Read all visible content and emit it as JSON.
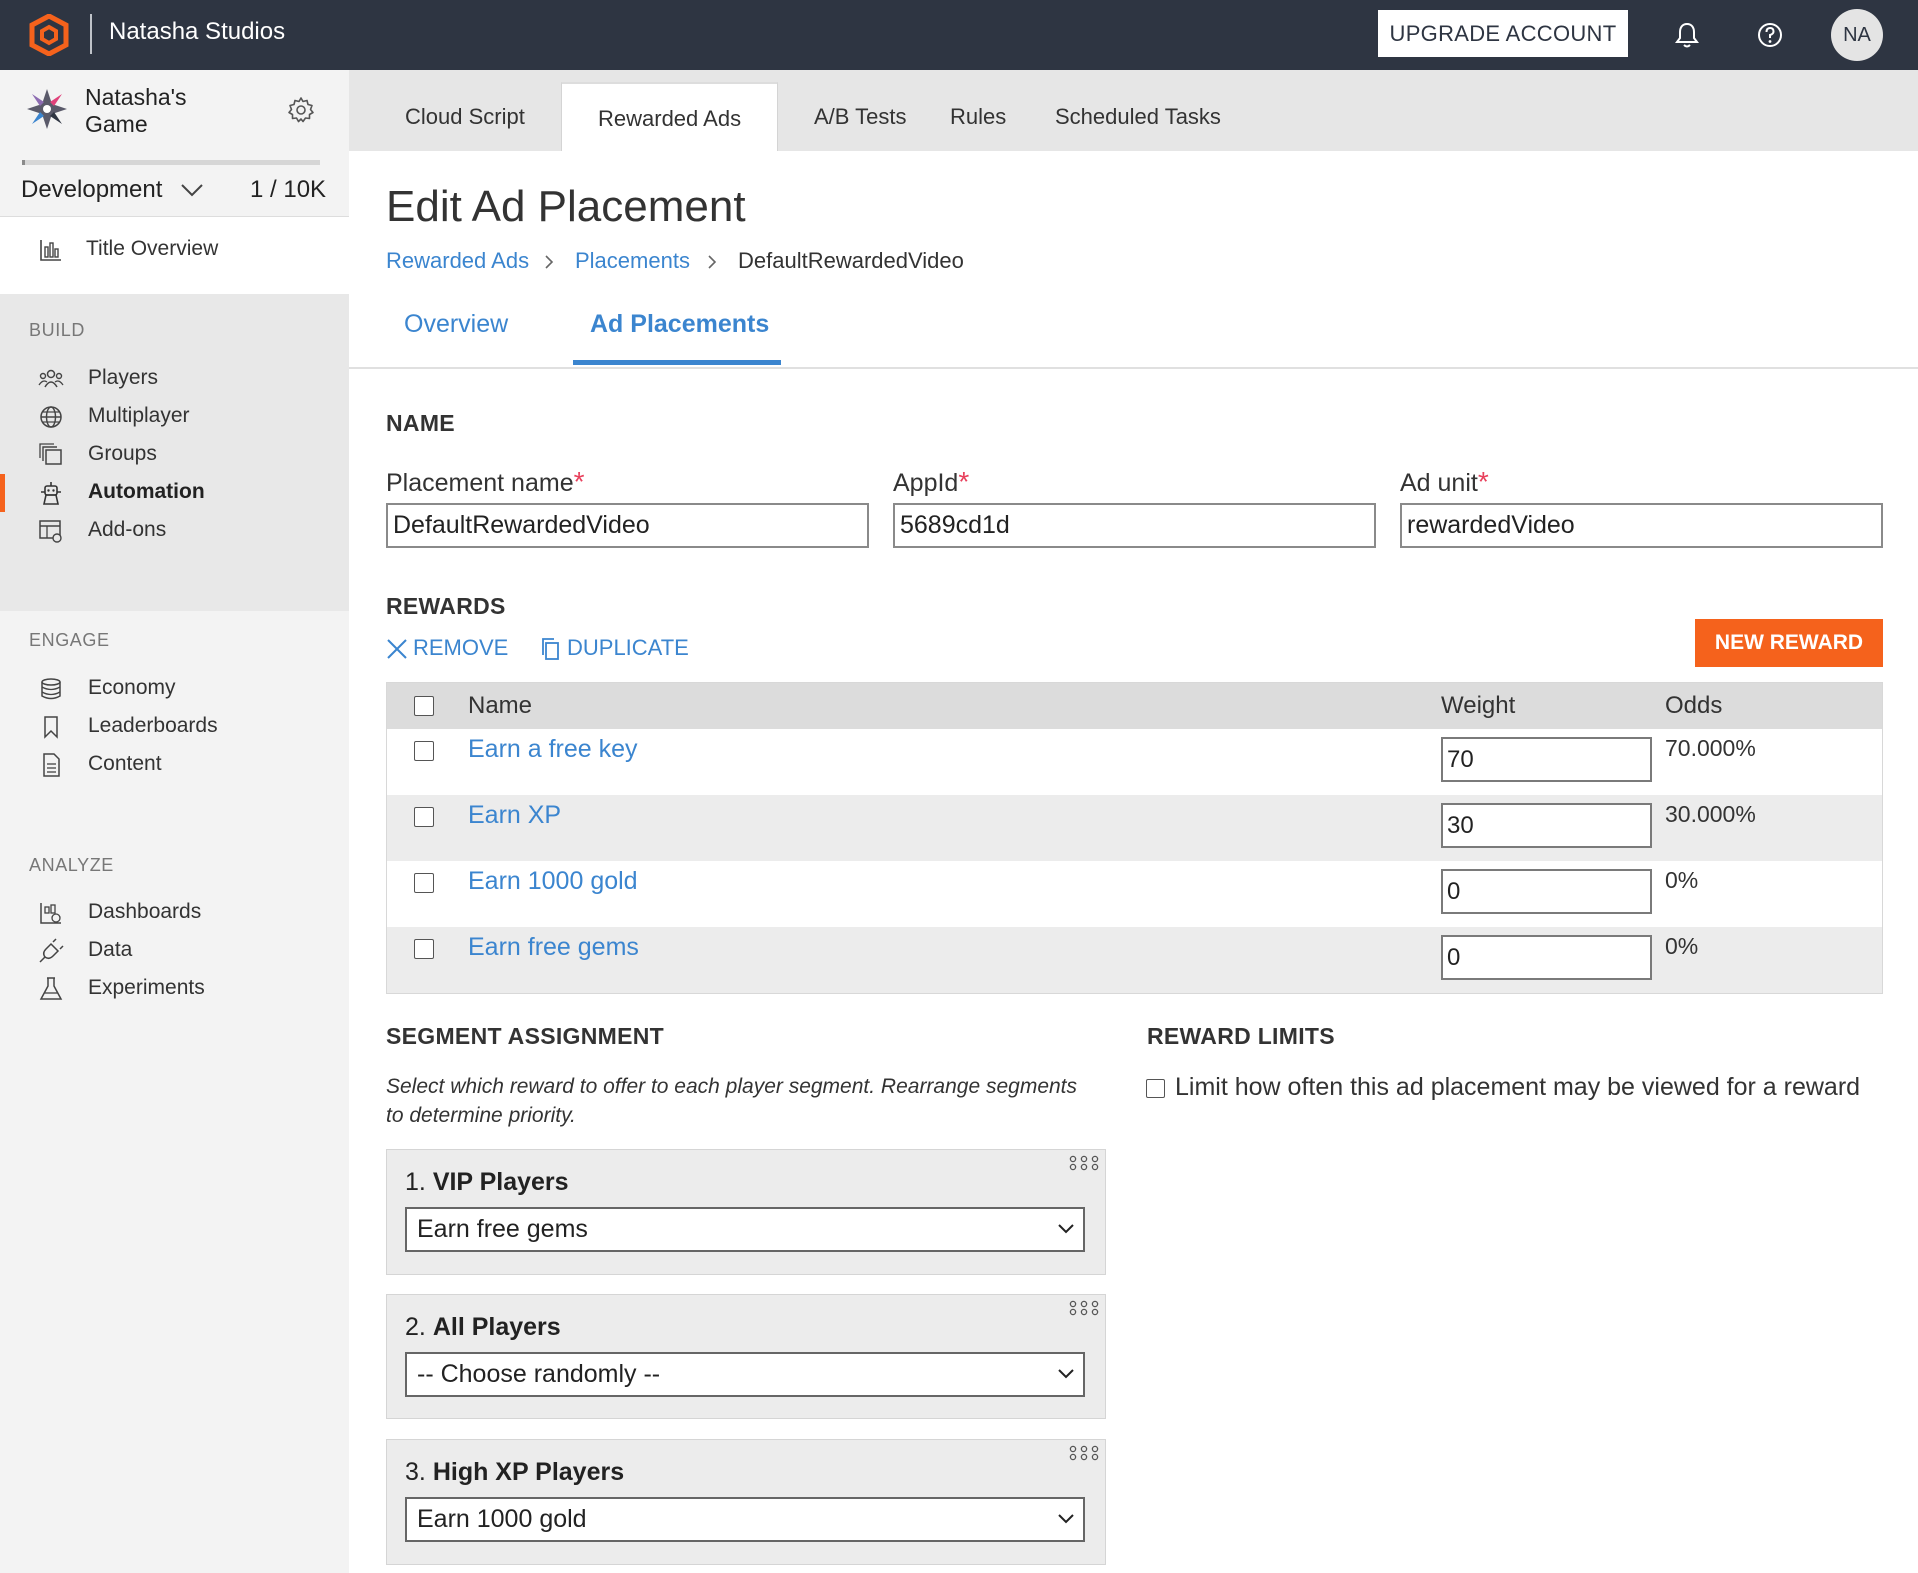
{
  "header": {
    "studio": "Natasha Studios",
    "upgrade_label": "UPGRADE ACCOUNT",
    "avatar": "NA",
    "icons": [
      "bell-icon",
      "help-icon"
    ]
  },
  "sidebar": {
    "game_name": "Natasha's Game",
    "environment": "Development",
    "count": "1 / 10K",
    "usage_fraction": 0.0001,
    "title_overview": "Title Overview",
    "sections": {
      "build": "BUILD",
      "engage": "ENGAGE",
      "analyze": "ANALYZE"
    },
    "build_items": [
      "Players",
      "Multiplayer",
      "Groups",
      "Automation",
      "Add-ons"
    ],
    "engage_items": [
      "Economy",
      "Leaderboards",
      "Content"
    ],
    "analyze_items": [
      "Dashboards",
      "Data",
      "Experiments"
    ],
    "active_item": "Automation"
  },
  "tabs": [
    "Cloud Script",
    "Rewarded Ads",
    "A/B Tests",
    "Rules",
    "Scheduled Tasks"
  ],
  "active_tab": "Rewarded Ads",
  "page": {
    "title": "Edit Ad Placement",
    "breadcrumb": [
      "Rewarded Ads",
      "Placements",
      "DefaultRewardedVideo"
    ],
    "subtabs": [
      "Overview",
      "Ad Placements"
    ],
    "active_subtab": "Ad Placements"
  },
  "name_section": {
    "heading": "NAME",
    "placement_label": "Placement name",
    "placement_value": "DefaultRewardedVideo",
    "appid_label": "AppId",
    "appid_value": "5689cd1d",
    "adunit_label": "Ad unit",
    "adunit_value": "rewardedVideo",
    "required_mark": "*"
  },
  "rewards": {
    "heading": "REWARDS",
    "remove_label": "REMOVE",
    "duplicate_label": "DUPLICATE",
    "new_label": "NEW REWARD",
    "columns": {
      "name": "Name",
      "weight": "Weight",
      "odds": "Odds"
    },
    "rows": [
      {
        "name": "Earn a free key",
        "weight": "70",
        "odds": "70.000%"
      },
      {
        "name": "Earn XP",
        "weight": "30",
        "odds": "30.000%"
      },
      {
        "name": "Earn 1000 gold",
        "weight": "0",
        "odds": "0%"
      },
      {
        "name": "Earn free gems",
        "weight": "0",
        "odds": "0%"
      }
    ]
  },
  "segments": {
    "heading": "SEGMENT ASSIGNMENT",
    "description": "Select which reward to offer to each player segment. Rearrange segments to determine priority.",
    "items": [
      {
        "num": "1.",
        "name": "VIP Players",
        "selected": "Earn free gems"
      },
      {
        "num": "2.",
        "name": "All Players",
        "selected": "-- Choose randomly --"
      },
      {
        "num": "3.",
        "name": "High XP Players",
        "selected": "Earn 1000 gold"
      }
    ]
  },
  "limits": {
    "heading": "REWARD LIMITS",
    "checkbox_label": "Limit how often this ad placement may be viewed for a reward"
  },
  "colors": {
    "topbar": "#2e3542",
    "accent": "#f5621c",
    "link": "#3b85cf",
    "required": "#e8405c"
  }
}
